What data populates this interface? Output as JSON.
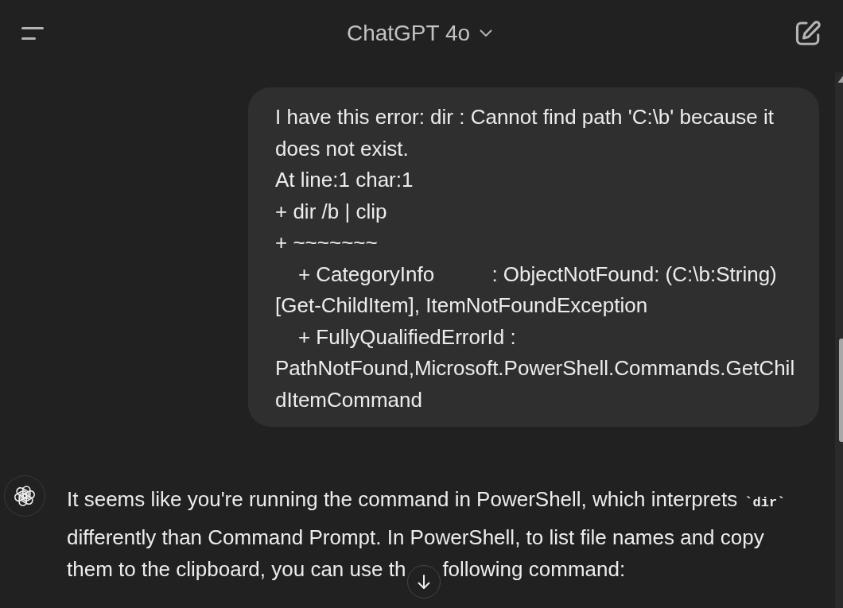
{
  "header": {
    "title": "ChatGPT 4o"
  },
  "conversation": [
    {
      "kind": "user",
      "lines": [
        "I have this error: dir : Cannot find path 'C:\\b' because it",
        "does not exist.",
        "At line:1 char:1",
        "+ dir /b | clip",
        "+ ~~~~~~~",
        "    + CategoryInfo          : ObjectNotFound: (C:\\b:String)",
        "[Get-ChildItem], ItemNotFoundException",
        "    + FullyQualifiedErrorId :",
        "PathNotFound,Microsoft.PowerShell.Commands.GetChil",
        "dItemCommand"
      ]
    },
    {
      "kind": "assistant",
      "lines": [
        [
          {
            "kind": "text",
            "text": "It seems like you're running the command in PowerShell, which interprets "
          },
          {
            "kind": "code",
            "text": "`dir`"
          }
        ],
        [
          {
            "kind": "text",
            "text": "differently than Command Prompt. In PowerShell, to list file names and copy"
          }
        ],
        [
          {
            "kind": "text",
            "text": "them to the clipboard, you can use th"
          },
          {
            "kind": "gap"
          },
          {
            "kind": "text",
            "text": "following command:"
          }
        ]
      ]
    }
  ]
}
